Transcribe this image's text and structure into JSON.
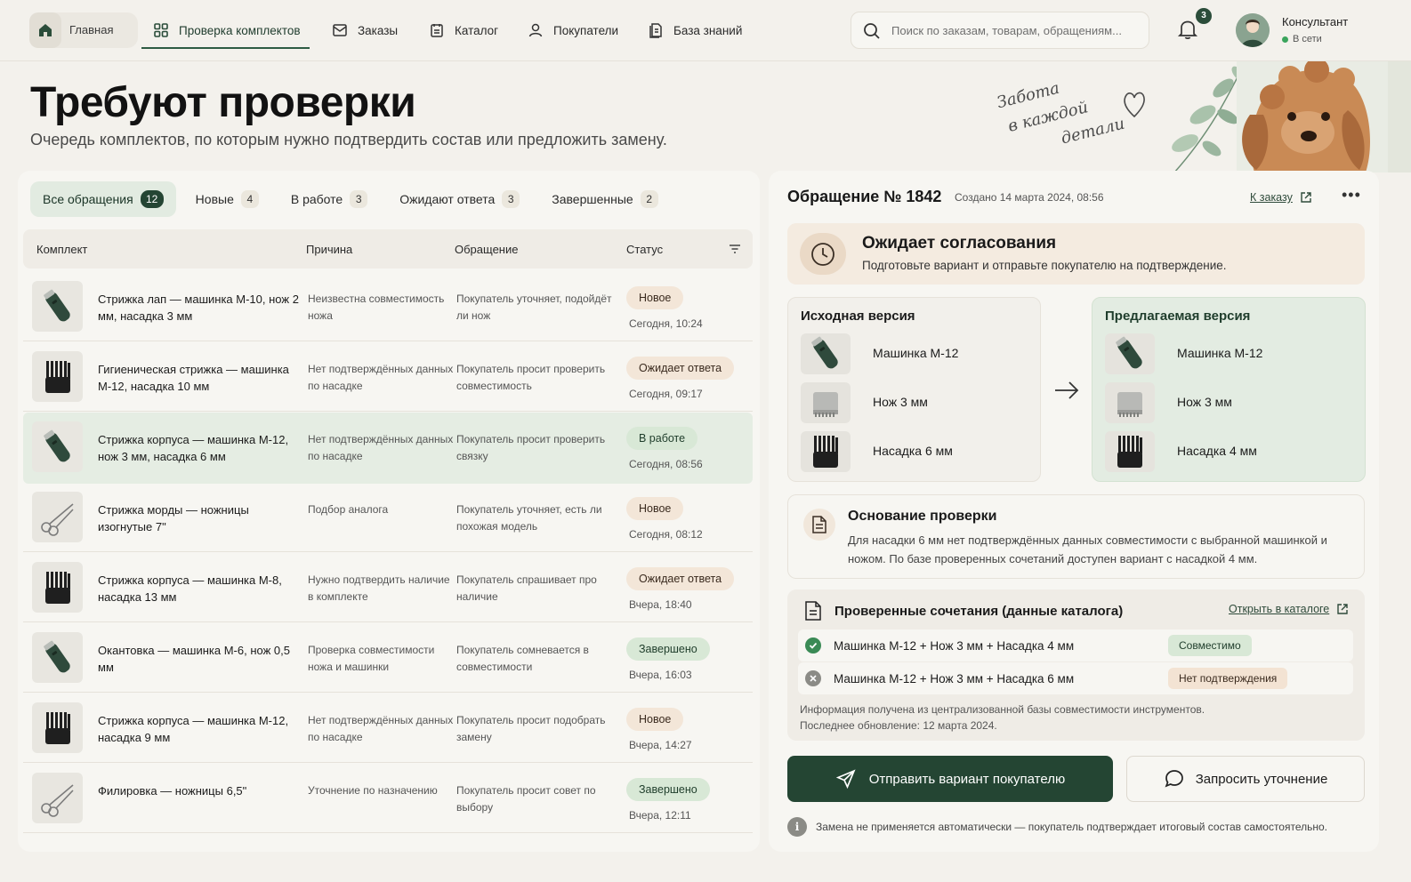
{
  "nav": {
    "home": "Главная",
    "items": [
      {
        "label": "Проверка комплектов",
        "icon": "grid-icon",
        "active": true
      },
      {
        "label": "Заказы",
        "icon": "inbox-icon"
      },
      {
        "label": "Каталог",
        "icon": "catalog-icon"
      },
      {
        "label": "Покупатели",
        "icon": "user-icon"
      },
      {
        "label": "База знаний",
        "icon": "book-icon"
      }
    ],
    "search_placeholder": "Поиск по заказам, товарам, обращениям...",
    "notifications": "3",
    "user": {
      "role": "Консультант",
      "status": "В сети"
    }
  },
  "header": {
    "title": "Требуют проверки",
    "subtitle": "Очередь комплектов, по которым нужно подтвердить состав или предложить замену.",
    "tagline": [
      "Забота",
      "в каждой",
      "детали"
    ]
  },
  "tabs": [
    {
      "label": "Все обращения",
      "count": "12",
      "active": true
    },
    {
      "label": "Новые",
      "count": "4"
    },
    {
      "label": "В работе",
      "count": "3"
    },
    {
      "label": "Ожидают ответа",
      "count": "3"
    },
    {
      "label": "Завершенные",
      "count": "2"
    }
  ],
  "table": {
    "columns": [
      "Комплект",
      "Причина",
      "Обращение",
      "Статус"
    ],
    "rows": [
      {
        "kit": "Стрижка лап — машинка М-10, нож 2 мм, насадка 3 мм",
        "reason": "Неизвестна совместимость ножа",
        "request": "Покупатель уточняет, подойдёт ли нож",
        "status": "Новое",
        "status_kind": "new",
        "time": "Сегодня, 10:24",
        "thumb": "clipper"
      },
      {
        "kit": "Гигиеническая стрижка — машинка М-12, насадка 10 мм",
        "reason": "Нет подтверждённых данных по насадке",
        "request": "Покупатель просит проверить совместимость",
        "status": "Ожидает ответа",
        "status_kind": "wait",
        "time": "Сегодня, 09:17",
        "thumb": "comb"
      },
      {
        "kit": "Стрижка корпуса — машинка М-12, нож 3 мм, насадка 6 мм",
        "reason": "Нет подтверждённых данных по насадке",
        "request": "Покупатель просит проверить связку",
        "status": "В работе",
        "status_kind": "work",
        "time": "Сегодня, 08:56",
        "thumb": "clipper",
        "selected": true
      },
      {
        "kit": "Стрижка морды — ножницы изогнутые 7\"",
        "reason": "Подбор аналога",
        "request": "Покупатель уточняет, есть ли похожая модель",
        "status": "Новое",
        "status_kind": "new",
        "time": "Сегодня, 08:12",
        "thumb": "scissors"
      },
      {
        "kit": "Стрижка корпуса — машинка М-8, насадка 13 мм",
        "reason": "Нужно подтвердить наличие в комплекте",
        "request": "Покупатель спрашивает про наличие",
        "status": "Ожидает ответа",
        "status_kind": "wait",
        "time": "Вчера, 18:40",
        "thumb": "comb"
      },
      {
        "kit": "Окантовка — машинка М-6, нож 0,5 мм",
        "reason": "Проверка совместимости ножа и машинки",
        "request": "Покупатель сомневается в совместимости",
        "status": "Завершено",
        "status_kind": "done",
        "time": "Вчера, 16:03",
        "thumb": "clipper"
      },
      {
        "kit": "Стрижка корпуса — машинка М-12, насадка 9 мм",
        "reason": "Нет подтверждённых данных по насадке",
        "request": "Покупатель просит подобрать замену",
        "status": "Новое",
        "status_kind": "new",
        "time": "Вчера, 14:27",
        "thumb": "comb"
      },
      {
        "kit": "Филировка — ножницы 6,5\"",
        "reason": "Уточнение по назначению",
        "request": "Покупатель просит совет по выбору",
        "status": "Завершено",
        "status_kind": "done",
        "time": "Вчера, 12:11",
        "thumb": "scissors"
      }
    ]
  },
  "detail": {
    "title": "Обращение № 1842",
    "created": "Создано 14 марта 2024, 08:56",
    "order_link": "К заказу",
    "status_title": "Ожидает согласования",
    "status_text": "Подготовьте вариант и отправьте покупателю на подтверждение.",
    "source": {
      "title": "Исходная версия",
      "items": [
        "Машинка М-12",
        "Нож 3 мм",
        "Насадка 6 мм"
      ]
    },
    "proposed": {
      "title": "Предлагаемая версия",
      "items": [
        "Машинка М-12",
        "Нож 3 мм",
        "Насадка 4 мм"
      ]
    },
    "basis_title": "Основание проверки",
    "basis_text": "Для насадки 6 мм нет подтверждённых данных совместимости с выбранной машинкой и ножом. По базе проверенных сочетаний доступен вариант с насадкой 4 мм.",
    "combos_title": "Проверенные сочетания (данные каталога)",
    "combos_link": "Открыть в каталоге",
    "combos": [
      {
        "label": "Машинка М-12 + Нож 3 мм + Насадка 4 мм",
        "badge": "Совместимо",
        "ok": true
      },
      {
        "label": "Машинка М-12 + Нож 3 мм + Насадка 6 мм",
        "badge": "Нет подтверждения",
        "ok": false
      }
    ],
    "combos_note_1": "Информация получена из централизованной базы совместимости инструментов.",
    "combos_note_2": "Последнее обновление: 12 марта 2024.",
    "send_button": "Отправить вариант покупателю",
    "ask_button": "Запросить уточнение",
    "footer_note": "Замена не применяется автоматически — покупатель подтверждает итоговый состав самостоятельно."
  },
  "colors": {
    "accent": "#244533",
    "accent_light": "#e2ebe1",
    "warm": "#f3e6d8",
    "background": "#f3f1ec"
  }
}
